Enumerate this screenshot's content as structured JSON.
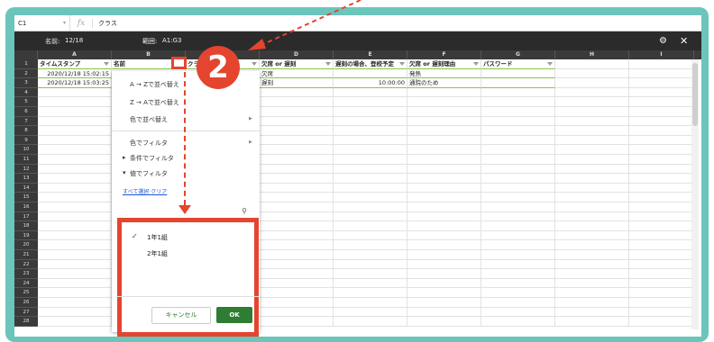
{
  "formula_bar": {
    "cell_ref": "C1",
    "fx": "fx",
    "value": "クラス"
  },
  "filter_bar": {
    "name_label": "名前:",
    "name_value": "12/18",
    "range_label": "範囲:",
    "range_value": "A1:G3"
  },
  "columns": [
    "A",
    "B",
    "C",
    "D",
    "E",
    "F",
    "G",
    "H",
    "I"
  ],
  "row_numbers": [
    "1",
    "2",
    "3",
    "4",
    "5",
    "6",
    "7",
    "8",
    "9",
    "10",
    "11",
    "12",
    "13",
    "14",
    "15",
    "16",
    "17",
    "18",
    "19",
    "20",
    "21",
    "22",
    "23",
    "24",
    "25",
    "26",
    "27",
    "28"
  ],
  "rows": [
    [
      "タイムスタンプ",
      "名前",
      "クラス",
      "欠席 or 遅刻",
      "遅刻の場合、登校予定",
      "欠席 or 遅刻理由",
      "パスワード"
    ],
    [
      "2020/12/18 15:02:15",
      "",
      "",
      "欠席",
      "",
      "発熱",
      ""
    ],
    [
      "2020/12/18 15:03:25",
      "",
      "",
      "遅刻",
      "10:00:00",
      "通院のため",
      ""
    ]
  ],
  "menu": {
    "sort_az": "A → Zで並べ替え",
    "sort_za": "Z → Aで並べ替え",
    "sort_color": "色で並べ替え",
    "filter_color": "色でフィルタ",
    "filter_condition": "条件でフィルタ",
    "filter_values": "値でフィルタ",
    "select_all": "すべて選択",
    "link_sep": "·",
    "clear": "クリア"
  },
  "options": [
    {
      "label": "1年1組",
      "checked": true
    },
    {
      "label": "2年1組",
      "checked": false
    }
  ],
  "buttons": {
    "cancel": "キャンセル",
    "ok": "OK"
  },
  "callout_number": "2",
  "colors": {
    "accent_red": "#e5442f",
    "teal": "#6cc5bb",
    "ok_green": "#2e7d32",
    "dark_bar": "#2b2b2b"
  }
}
